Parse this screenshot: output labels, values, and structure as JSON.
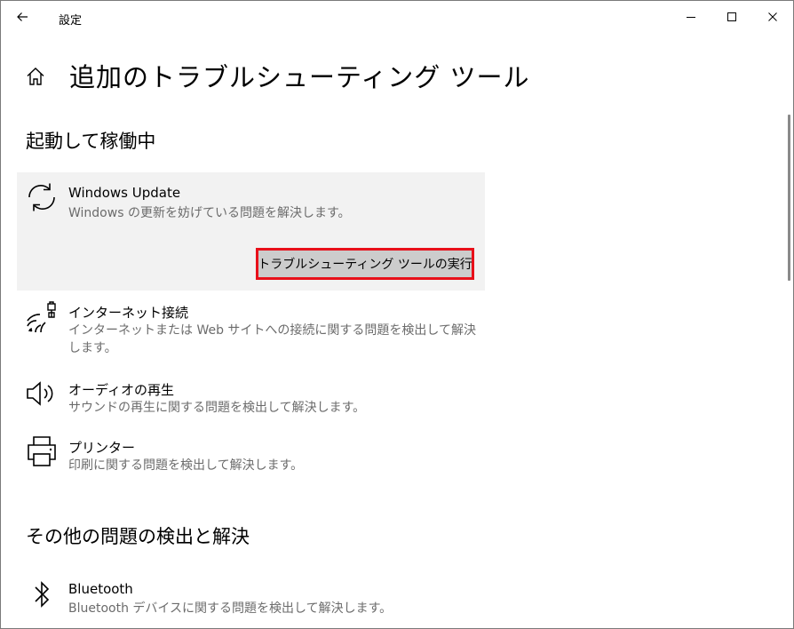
{
  "window": {
    "title": "設定"
  },
  "page": {
    "title": "追加のトラブルシューティング ツール"
  },
  "sections": [
    {
      "title": "起動して稼働中",
      "items": [
        {
          "name": "Windows Update",
          "description": "Windows の更新を妨げている問題を解決します。",
          "icon": "sync-icon",
          "selected": true,
          "button_label": "トラブルシューティング ツールの実行"
        },
        {
          "name": "インターネット接続",
          "description": "インターネットまたは Web サイトへの接続に関する問題を検出して解決します。",
          "icon": "wifi-ethernet-icon"
        },
        {
          "name": "オーディオの再生",
          "description": "サウンドの再生に関する問題を検出して解決します。",
          "icon": "speaker-icon"
        },
        {
          "name": "プリンター",
          "description": "印刷に関する問題を検出して解決します。",
          "icon": "printer-icon"
        }
      ]
    },
    {
      "title": "その他の問題の検出と解決",
      "items": [
        {
          "name": "Bluetooth",
          "description": "Bluetooth デバイスに関する問題を検出して解決します。",
          "icon": "bluetooth-icon"
        }
      ]
    }
  ],
  "colors": {
    "selected_background": "#f2f2f2",
    "button_background": "#cccccc",
    "highlight_border": "#e8101a",
    "description_text": "#6b6b6b"
  }
}
